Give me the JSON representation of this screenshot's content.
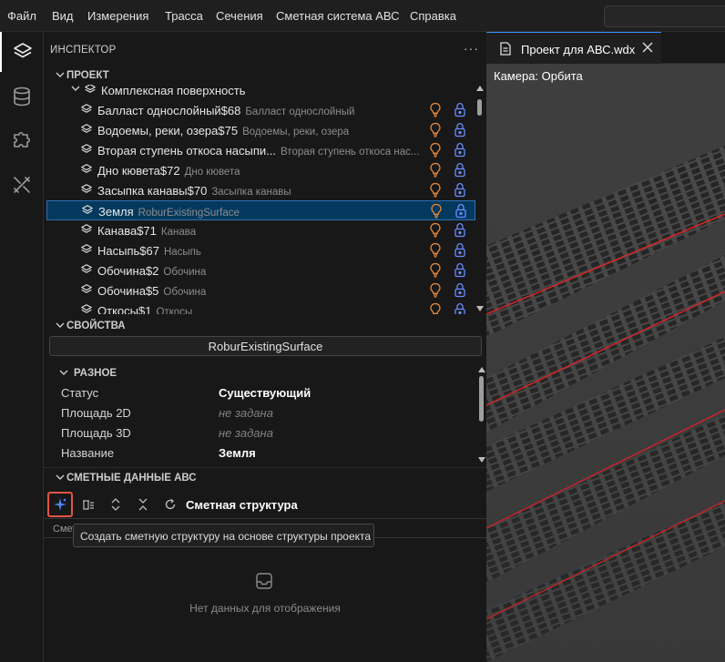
{
  "menu": [
    "Файл",
    "Вид",
    "Измерения",
    "Трасса",
    "Сечения",
    "Сметная система АВС",
    "Справка"
  ],
  "inspector": {
    "title": "ИНСПЕКТОР",
    "more": "···",
    "project_section": "ПРОЕКТ",
    "tree_parent": "Комплексная поверхность",
    "tree": [
      {
        "name": "Балласт однослойный$68",
        "desc": "Балласт однослойный",
        "selected": false
      },
      {
        "name": "Водоемы, реки, озера$75",
        "desc": "Водоемы, реки, озера",
        "selected": false
      },
      {
        "name": "Вторая ступень откоса насыпи...",
        "desc": "Вторая ступень откоса нас...",
        "selected": false
      },
      {
        "name": "Дно кювета$72",
        "desc": "Дно кювета",
        "selected": false
      },
      {
        "name": "Засыпка канавы$70",
        "desc": "Засыпка канавы",
        "selected": false
      },
      {
        "name": "Земля",
        "desc": "RoburExistingSurface",
        "selected": true
      },
      {
        "name": "Канава$71",
        "desc": "Канава",
        "selected": false
      },
      {
        "name": "Насыпь$67",
        "desc": "Насыпь",
        "selected": false
      },
      {
        "name": "Обочина$2",
        "desc": "Обочина",
        "selected": false
      },
      {
        "name": "Обочина$5",
        "desc": "Обочина",
        "selected": false
      },
      {
        "name": "Откосы$1",
        "desc": "Откосы",
        "selected": false
      }
    ],
    "properties_section": "СВОЙСТВА",
    "properties_value": "RoburExistingSurface",
    "misc_section": "РАЗНОЕ",
    "properties": [
      {
        "key": "Статус",
        "value": "Существующий",
        "empty": false
      },
      {
        "key": "Площадь 2D",
        "value": "не задана",
        "empty": true
      },
      {
        "key": "Площадь 3D",
        "value": "не задана",
        "empty": true
      },
      {
        "key": "Название",
        "value": "Земля",
        "empty": false
      }
    ],
    "estimate_section": "СМЕТНЫЕ ДАННЫЕ АВС",
    "toolbar_label": "Сметная структура",
    "column_header": "Сметн",
    "tooltip": "Создать сметную структуру на основе структуры проекта",
    "empty_text": "Нет данных для отображения"
  },
  "editor": {
    "tab_title": "Проект для АВС.wdx",
    "camera_label": "Камера: Орбита"
  },
  "colors": {
    "accent": "#3794ff",
    "bulb": "#e8883a",
    "lock": "#6b8cff",
    "highlight": "#e25447",
    "line": "#ff2020"
  }
}
